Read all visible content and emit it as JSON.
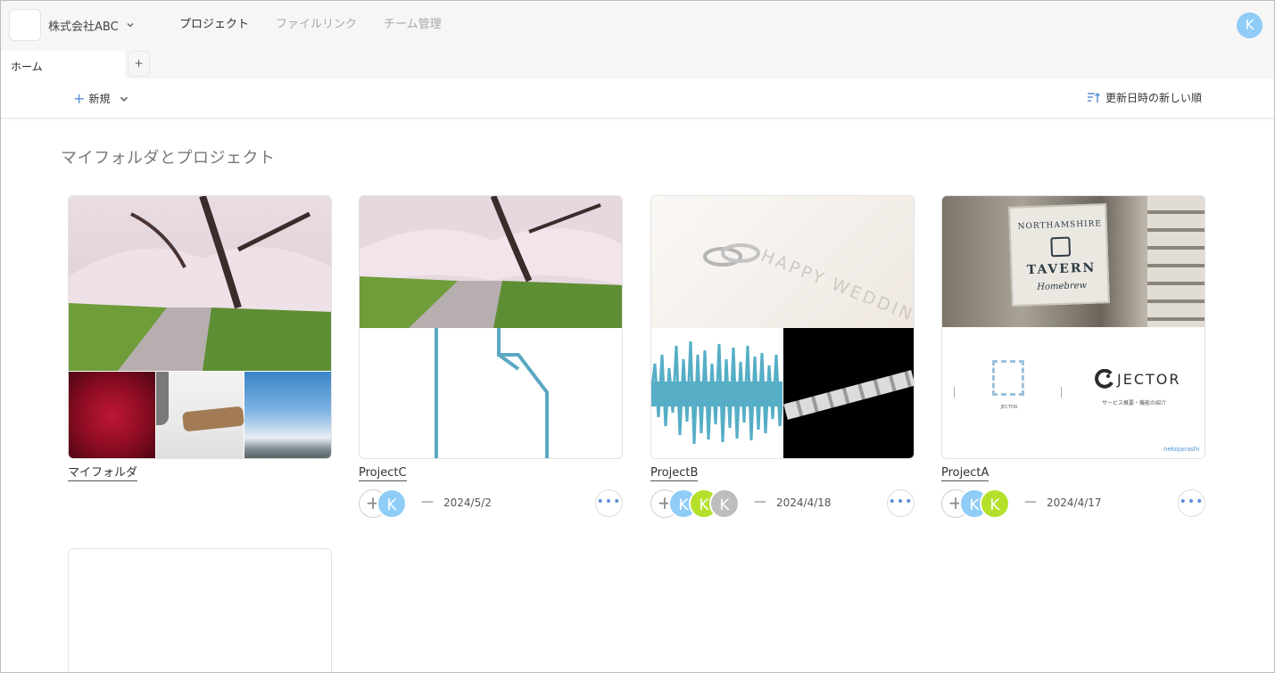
{
  "org": {
    "name": "株式会社ABC",
    "logo_icon": "org-logo-icon"
  },
  "nav": [
    {
      "label": "プロジェクト",
      "active": true
    },
    {
      "label": "ファイルリンク",
      "active": false
    },
    {
      "label": "チーム管理",
      "active": false
    }
  ],
  "user": {
    "initial": "K",
    "color": "#8fccf7"
  },
  "tabs": [
    {
      "label": "ホーム"
    }
  ],
  "tab_add_label": "+",
  "toolbar": {
    "new_label": "新規",
    "sort_label": "更新日時の新しい順"
  },
  "section_title": "マイフォルダとプロジェクト",
  "cards": [
    {
      "title": "マイフォルダ",
      "kind": "folder"
    },
    {
      "title": "ProjectC",
      "date": "2024/5/2",
      "dash": "—",
      "members": [
        {
          "initial": "K",
          "color": "#8fccf7"
        }
      ]
    },
    {
      "title": "ProjectB",
      "date": "2024/4/18",
      "dash": "—",
      "members": [
        {
          "initial": "K",
          "color": "#8fccf7"
        },
        {
          "initial": "K",
          "color": "#b5e02a"
        },
        {
          "initial": "K",
          "color": "#bdbdbd"
        }
      ]
    },
    {
      "title": "ProjectA",
      "date": "2024/4/17",
      "dash": "—",
      "members": [
        {
          "initial": "K",
          "color": "#8fccf7"
        },
        {
          "initial": "K",
          "color": "#b5e02a"
        }
      ]
    }
  ],
  "thumbnail_text": {
    "wedding": "HAPPY WEDDING",
    "tavern_line1": "NORTHAMSHIRE",
    "tavern_line2": "TAVERN",
    "tavern_line3": "Homebrew",
    "jector": "JECTOR",
    "jector_sub": "サービス概要・機能の紹介",
    "jector_small": "JECTOR",
    "brand_mark": "nekojarashi"
  },
  "more_label": "•••",
  "add_member_label": "+"
}
